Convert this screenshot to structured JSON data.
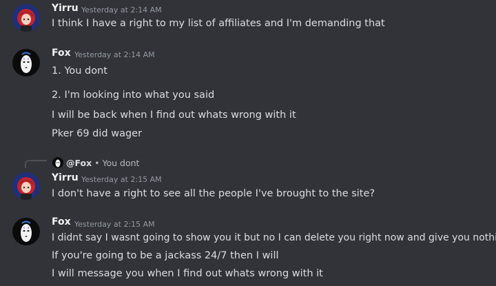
{
  "messages": [
    {
      "author": "Yirru",
      "timestamp": "Yesterday at 2:14 AM",
      "lines": [
        "I think I have a right to my list of affiliates and I'm demanding that"
      ]
    },
    {
      "author": "Fox",
      "timestamp": "Yesterday at 2:14 AM",
      "lines": [
        "1. You dont",
        "2. I'm looking into what you said",
        "I will be back when I find out whats wrong with it",
        "Pker 69 did wager"
      ]
    },
    {
      "reply": {
        "mention": "@Fox",
        "separator": "•",
        "text": "You dont"
      },
      "author": "Yirru",
      "timestamp": "Yesterday at 2:15 AM",
      "lines": [
        "I don't have a right to see all the people I've brought to the site?"
      ]
    },
    {
      "author": "Fox",
      "timestamp": "Yesterday at 2:15 AM",
      "lines": [
        "I didnt say I wasnt going to show you it but no I can delete you right now and give you nothing",
        "If you're going to be a jackass 24/7 then I will",
        "I will message you when I find out whats wrong with it"
      ]
    }
  ]
}
